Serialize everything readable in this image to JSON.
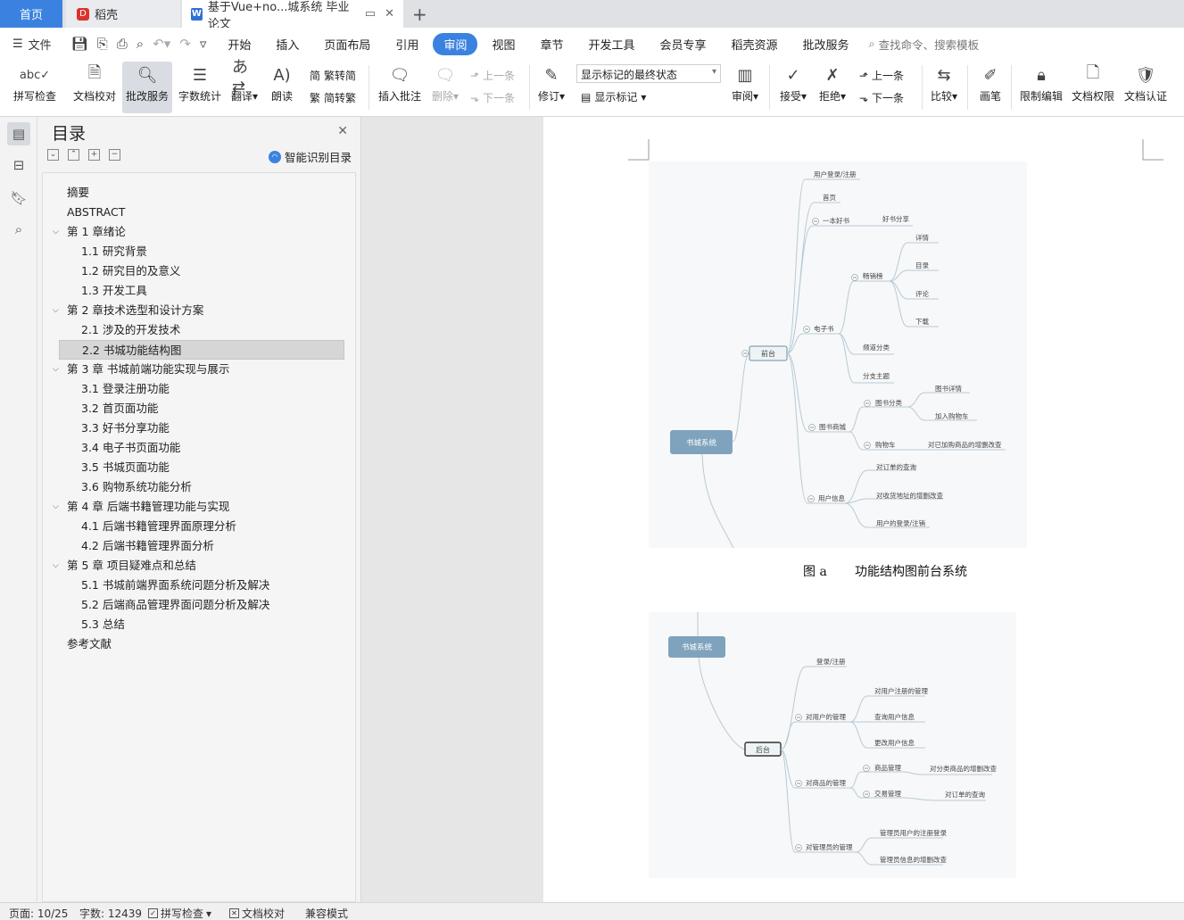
{
  "tabs": {
    "home": "首页",
    "daoke": "稻壳",
    "doc": "基于Vue+no...城系统 毕业论文"
  },
  "menu": {
    "file": "文件",
    "items": [
      "开始",
      "插入",
      "页面布局",
      "引用",
      "审阅",
      "视图",
      "章节",
      "开发工具",
      "会员专享",
      "稻壳资源",
      "批改服务"
    ],
    "active": "审阅",
    "search": "查找命令、搜索模板"
  },
  "ribbon": {
    "spell": "拼写检查",
    "proof": "文档校对",
    "correct": "批改服务",
    "wordcount": "字数统计",
    "translate": "翻译",
    "read": "朗读",
    "trad": "繁转简",
    "simp": "简转繁",
    "insert_comment": "插入批注",
    "delete": "删除",
    "prev": "上一条",
    "next": "下一条",
    "revise": "修订",
    "markup_state": "显示标记的最终状态",
    "show_markup": "显示标记",
    "review": "审阅",
    "accept": "接受",
    "reject": "拒绝",
    "prev2": "上一条",
    "next2": "下一条",
    "compare": "比较",
    "pen": "画笔",
    "restrict": "限制编辑",
    "perm": "文档权限",
    "cert": "文档认证"
  },
  "toc": {
    "title": "目录",
    "smart": "智能识别目录",
    "items": [
      {
        "label": "摘要",
        "level": 1,
        "chev": false
      },
      {
        "label": "ABSTRACT",
        "level": 1,
        "chev": false
      },
      {
        "label": "第 1 章绪论",
        "level": 1,
        "chev": true
      },
      {
        "label": "1.1  研究背景",
        "level": 2,
        "chev": false
      },
      {
        "label": "1.2  研究目的及意义",
        "level": 2,
        "chev": false
      },
      {
        "label": "1.3  开发工具",
        "level": 2,
        "chev": false
      },
      {
        "label": "第 2 章技术选型和设计方案",
        "level": 1,
        "chev": true
      },
      {
        "label": "2.1  涉及的开发技术",
        "level": 2,
        "chev": false
      },
      {
        "label": "2.2  书城功能结构图",
        "level": 2,
        "chev": false,
        "selected": true
      },
      {
        "label": "第 3 章  书城前端功能实现与展示",
        "level": 1,
        "chev": true
      },
      {
        "label": "3.1  登录注册功能",
        "level": 2,
        "chev": false
      },
      {
        "label": "3.2  首页面功能",
        "level": 2,
        "chev": false
      },
      {
        "label": "3.3  好书分享功能",
        "level": 2,
        "chev": false
      },
      {
        "label": "3.4  电子书页面功能",
        "level": 2,
        "chev": false
      },
      {
        "label": "3.5  书城页面功能",
        "level": 2,
        "chev": false
      },
      {
        "label": "3.6  购物系统功能分析",
        "level": 2,
        "chev": false
      },
      {
        "label": "第 4 章  后端书籍管理功能与实现",
        "level": 1,
        "chev": true
      },
      {
        "label": "4.1  后端书籍管理界面原理分析",
        "level": 2,
        "chev": false
      },
      {
        "label": "4.2  后端书籍管理界面分析",
        "level": 2,
        "chev": false
      },
      {
        "label": "第 5 章  项目疑难点和总结",
        "level": 1,
        "chev": true
      },
      {
        "label": "5.1  书城前端界面系统问题分析及解决",
        "level": 2,
        "chev": false
      },
      {
        "label": "5.2  后端商品管理界面问题分析及解决",
        "level": 2,
        "chev": false
      },
      {
        "label": "5.3  总结",
        "level": 2,
        "chev": false
      },
      {
        "label": "参考文献",
        "level": 1,
        "chev": false
      }
    ]
  },
  "figure_a": {
    "root": "书城系统",
    "hub": "前台",
    "labels": [
      "用户登录/注册",
      "首页",
      "一本好书",
      "好书分享",
      "电子书",
      "畅销榜",
      "详情",
      "目录",
      "评论",
      "下载",
      "频道分类",
      "分支主题",
      "图书商城",
      "图书分类",
      "图书详情",
      "加入购物车",
      "购物车",
      "对已加购商品的增删改查",
      "用户信息",
      "对订单的查询",
      "对收货地址的增删改查",
      "用户的登录/注销"
    ],
    "caption": "图 a       功能结构图前台系统"
  },
  "figure_b": {
    "root": "书城系统",
    "hub": "后台",
    "labels": [
      "登录/注册",
      "对用户的管理",
      "对用户注册的管理",
      "查询用户信息",
      "更改用户信息",
      "对商品的管理",
      "商品管理",
      "对分类商品的增删改查",
      "交易管理",
      "对订单的查询",
      "对管理员的管理",
      "管理员用户的注册登录",
      "管理员信息的增删改查"
    ]
  },
  "status": {
    "page": "页面: 10/25",
    "words": "字数: 12439",
    "spell": "拼写检查",
    "proof": "文档校对",
    "compat": "兼容模式"
  }
}
